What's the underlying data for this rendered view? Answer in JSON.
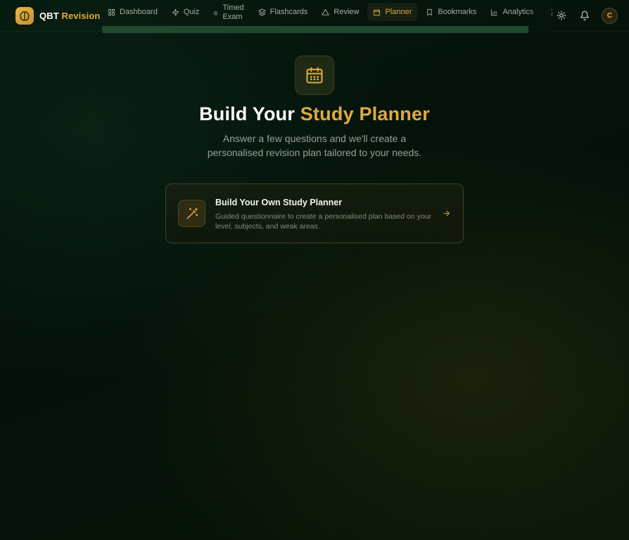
{
  "app": {
    "name_part1": "QBT",
    "name_part2": "Revision",
    "brand_color": "#e0a93e",
    "logo_icon": "brain-icon"
  },
  "nav": {
    "items": [
      {
        "label": "Dashboard",
        "icon": "layout-grid-icon"
      },
      {
        "label": "Quiz",
        "icon": "zap-icon"
      },
      {
        "label_line1": "Timed",
        "label_line2": "Exam",
        "icon": "timer-icon"
      },
      {
        "label": "Flashcards",
        "icon": "layers-icon"
      },
      {
        "label": "Review",
        "icon": "warning-triangle-icon"
      },
      {
        "label": "Planner",
        "icon": "calendar-icon",
        "active": true
      },
      {
        "label": "Bookmarks",
        "icon": "bookmark-icon"
      },
      {
        "label": "Analytics",
        "icon": "bar-chart-icon"
      },
      {
        "label": "B",
        "icon": "award-icon"
      }
    ]
  },
  "header_actions": {
    "theme_icon": "sun-icon",
    "notifications_icon": "bell-icon",
    "avatar_initial": "C"
  },
  "hero": {
    "icon": "calendar-icon",
    "title_part1": "Build Your",
    "title_part2": "Study Planner",
    "subtitle": "Answer a few questions and we'll create a personalised revision plan tailored to your needs."
  },
  "card": {
    "icon": "magic-wand-icon",
    "title": "Build Your Own Study Planner",
    "description": "Guided questionnaire to create a personalised plan based on your level, subjects, and weak areas.",
    "arrow_icon": "arrow-right-icon"
  }
}
